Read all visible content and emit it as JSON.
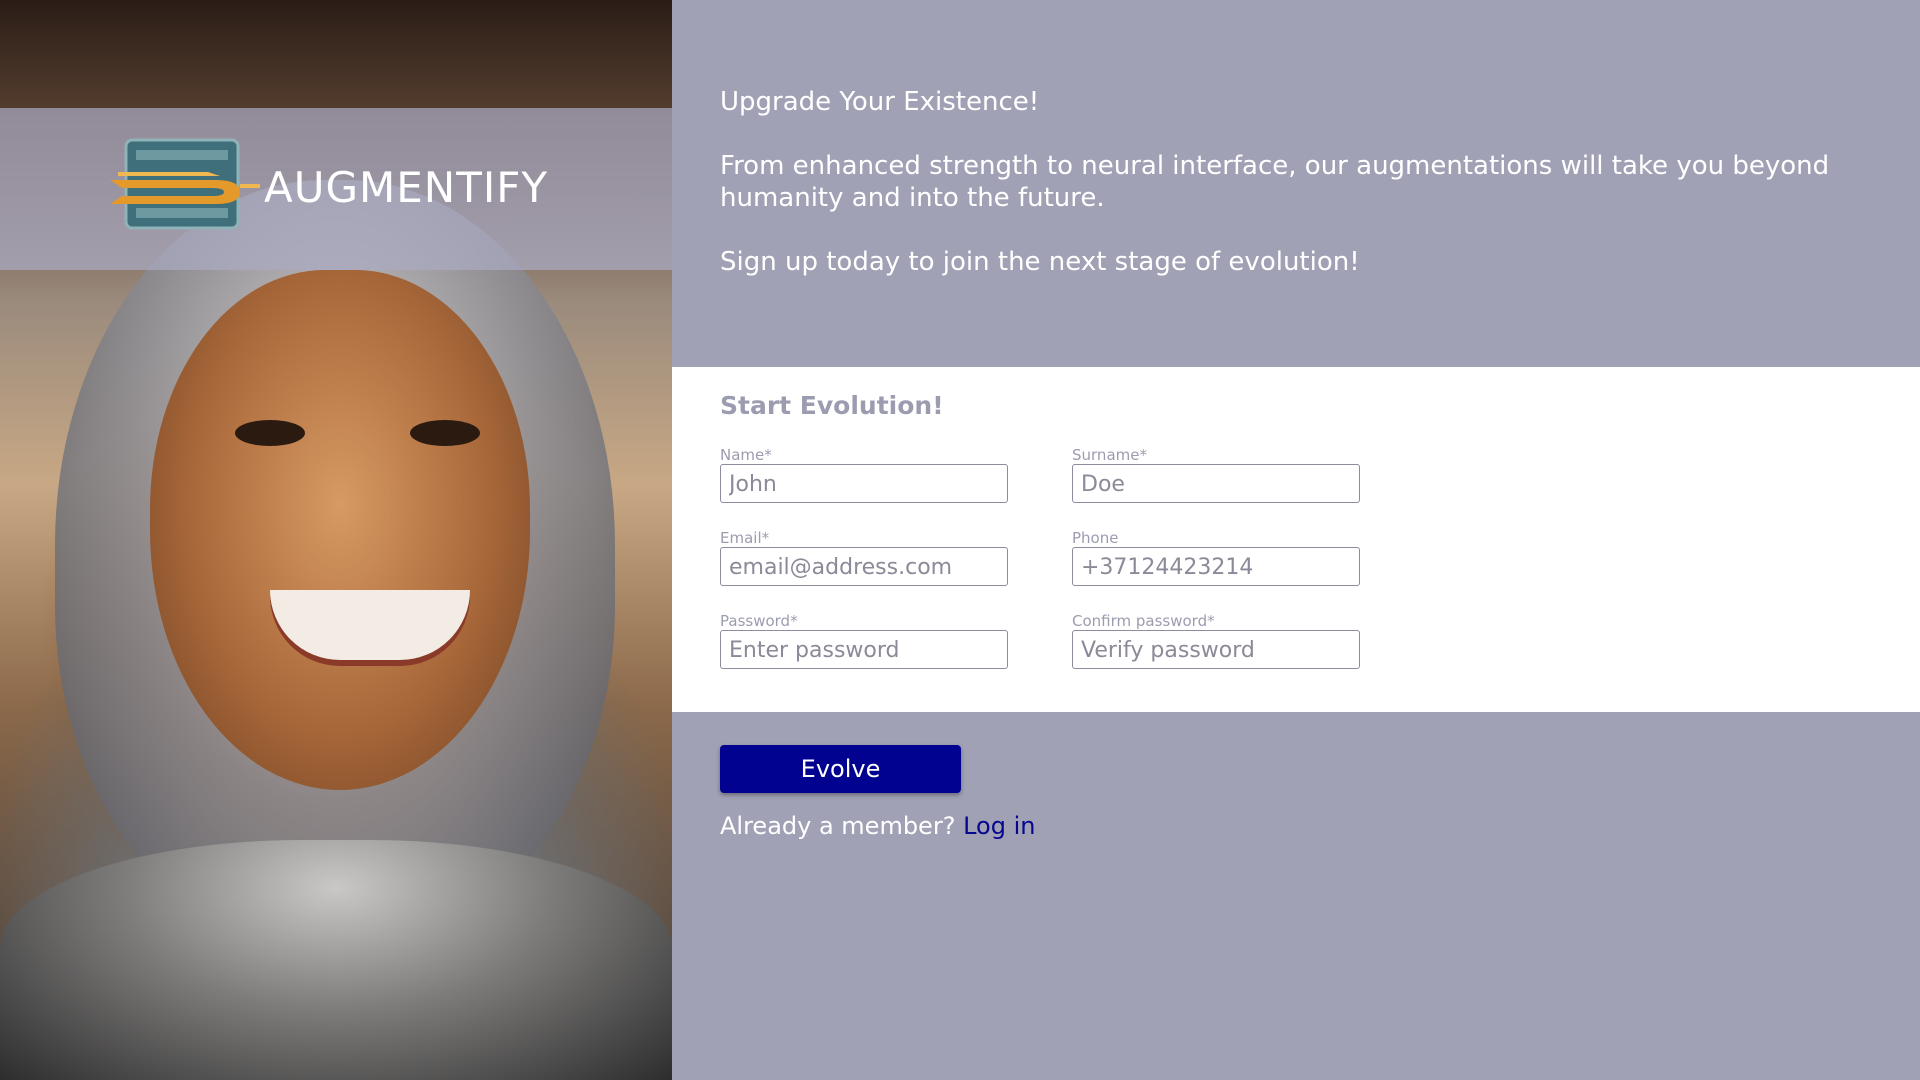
{
  "brand": {
    "name": "AUGMENTIFY",
    "logo_icon": "augmentify-logo-icon"
  },
  "intro": {
    "headline": "Upgrade Your Existence!",
    "body": "From enhanced strength to neural interface, our augmentations will take you beyond humanity and into the future.",
    "cta": "Sign up today to join the next stage of evolution!"
  },
  "form": {
    "title": "Start Evolution!",
    "fields": {
      "name": {
        "label": "Name*",
        "value": "John",
        "placeholder": ""
      },
      "surname": {
        "label": "Surname*",
        "value": "Doe",
        "placeholder": ""
      },
      "email": {
        "label": "Email*",
        "value": "email@address.com",
        "placeholder": ""
      },
      "phone": {
        "label": "Phone",
        "value": "+37124423214",
        "placeholder": ""
      },
      "password": {
        "label": "Password*",
        "value": "",
        "placeholder": "Enter password"
      },
      "confirm_password": {
        "label": "Confirm password*",
        "value": "",
        "placeholder": "Verify password"
      }
    },
    "submit_label": "Evolve"
  },
  "footer": {
    "member_text": "Already a member?",
    "login_label": "Log in"
  },
  "colors": {
    "background": "#a1a1b6",
    "form_background": "#ffffff",
    "button": "#020291",
    "link": "#06068f",
    "muted_label": "#9c9cb0"
  }
}
